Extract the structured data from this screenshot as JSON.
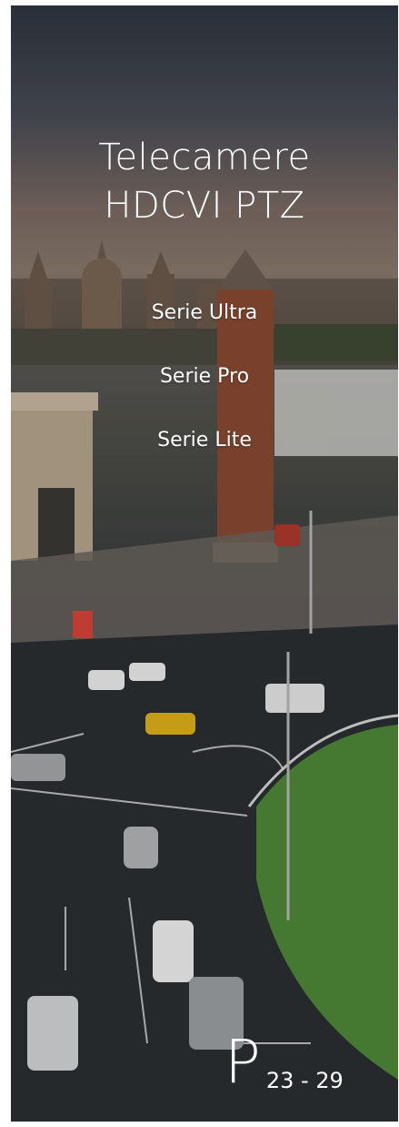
{
  "card": {
    "title_line1": "Telecamere",
    "title_line2": "HDCVI PTZ",
    "series": [
      {
        "label": "Serie Ultra"
      },
      {
        "label": "Serie Pro"
      },
      {
        "label": "Serie Lite"
      }
    ],
    "page_letter": "P",
    "page_range": "23 - 29"
  },
  "colors": {
    "text": "#ffffff",
    "grass": "#4f8a3a",
    "tower_brick": "#8a4a33"
  }
}
